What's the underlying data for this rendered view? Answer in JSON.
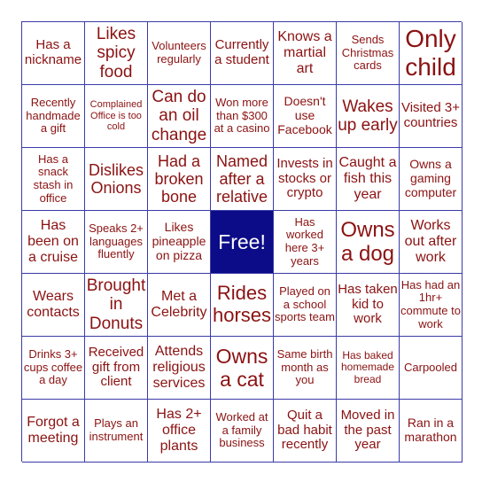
{
  "colors": {
    "text": "#8b1212",
    "border": "#3b3ba8",
    "free_bg": "#0c0c88",
    "free_text": "#ffffff"
  },
  "cells": [
    [
      "Has a nickname",
      "Likes spicy food",
      "Volunteers regularly",
      "Currently a student",
      "Knows a martial art",
      "Sends Christmas cards",
      "Only child"
    ],
    [
      "Recently handmade a gift",
      "Complained Office is too cold",
      "Can do an oil change",
      "Won more than $300 at a casino",
      "Doesn't use Facebook",
      "Wakes up early",
      "Visited 3+ countries"
    ],
    [
      "Has a snack stash in office",
      "Dislikes Onions",
      "Had a broken bone",
      "Named after a relative",
      "Invests in stocks or crypto",
      "Caught a fish this year",
      "Owns a gaming computer"
    ],
    [
      "Has been on a cruise",
      "Speaks 2+ languages fluently",
      "Likes pineapple on pizza",
      "Free!",
      "Has worked here 3+ years",
      "Owns a dog",
      "Works out after work"
    ],
    [
      "Wears contacts",
      "Brought in Donuts",
      "Met a Celebrity",
      "Rides horses",
      "Played on a school sports team",
      "Has taken kid to work",
      "Has had an 1hr+ commute to work"
    ],
    [
      "Drinks 3+ cups coffee a day",
      "Received gift from client",
      "Attends religious services",
      "Owns a cat",
      "Same birth month as you",
      "Has baked homemade bread",
      "Carpooled"
    ],
    [
      "Forgot a meeting",
      "Plays an instrument",
      "Has 2+ office plants",
      "Worked at a family business",
      "Quit a bad habit recently",
      "Moved in the past year",
      "Ran in a marathon"
    ]
  ]
}
